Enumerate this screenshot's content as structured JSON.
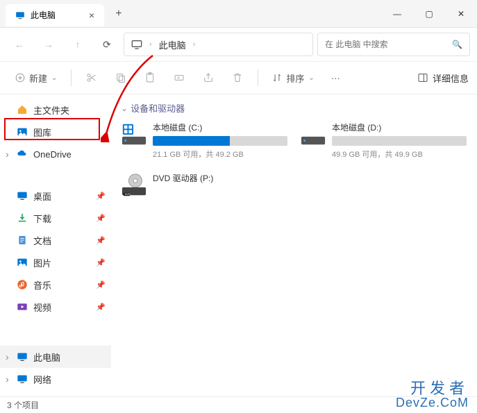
{
  "window": {
    "title": "此电脑",
    "minimize": "—",
    "maximize": "▢",
    "close": "✕",
    "newtab": "+",
    "tab_close": "×"
  },
  "nav": {
    "back": "←",
    "forward": "→",
    "up": "↑",
    "refresh": "⟳"
  },
  "breadcrumb": {
    "location": "此电脑",
    "sep": "›"
  },
  "search": {
    "placeholder": "在 此电脑 中搜索",
    "icon": "🔍"
  },
  "cmdbar": {
    "new": "新建",
    "new_chevron": "⌄",
    "sort": "排序",
    "sort_chevron": "⌄",
    "more": "···",
    "details": "详细信息"
  },
  "sidebar": {
    "items": [
      {
        "label": "主文件夹",
        "icon": "home"
      },
      {
        "label": "图库",
        "icon": "gallery"
      },
      {
        "label": "OneDrive",
        "icon": "cloud",
        "exp": true
      },
      {
        "label": "桌面",
        "icon": "desktop",
        "pin": true
      },
      {
        "label": "下载",
        "icon": "download",
        "pin": true
      },
      {
        "label": "文档",
        "icon": "docs",
        "pin": true
      },
      {
        "label": "图片",
        "icon": "pictures",
        "pin": true
      },
      {
        "label": "音乐",
        "icon": "music",
        "pin": true
      },
      {
        "label": "视频",
        "icon": "video",
        "pin": true
      },
      {
        "label": "此电脑",
        "icon": "pc",
        "exp": true,
        "active": true
      },
      {
        "label": "网络",
        "icon": "network",
        "exp": true
      }
    ]
  },
  "content": {
    "section": "设备和驱动器",
    "drives": [
      {
        "name": "本地磁盘 (C:)",
        "status": "21.1 GB 可用，共 49.2 GB",
        "fill": 57,
        "icon": "hdd-win"
      },
      {
        "name": "本地磁盘 (D:)",
        "status": "49.9 GB 可用，共 49.9 GB",
        "fill": 0,
        "icon": "hdd"
      },
      {
        "name": "DVD 驱动器 (P:)",
        "status": "",
        "fill": -1,
        "icon": "dvd"
      }
    ]
  },
  "statusbar": "3 个项目",
  "watermark": {
    "l1": "开发者",
    "l2": "DevZe.CoM"
  }
}
